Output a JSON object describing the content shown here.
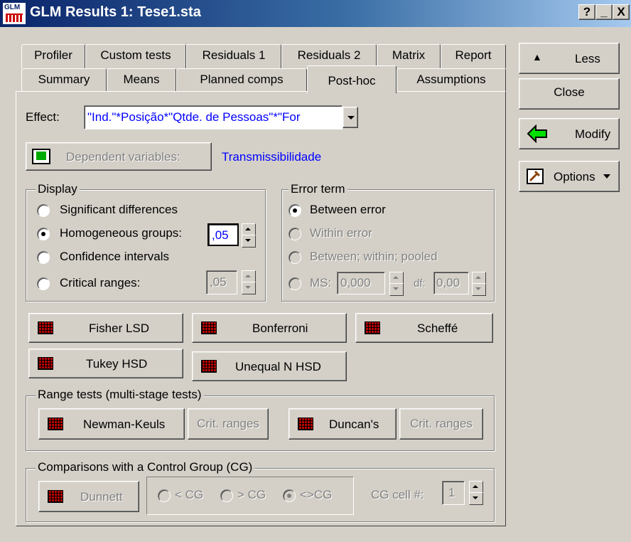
{
  "window": {
    "icon_text": "GLM",
    "title": "GLM Results 1: Tese1.sta",
    "help_btn": "?",
    "min_btn": "_",
    "close_btn": "X"
  },
  "tabs_row1": [
    "Profiler",
    "Custom tests",
    "Residuals 1",
    "Residuals 2",
    "Matrix",
    "Report"
  ],
  "tabs_row2": [
    "Summary",
    "Means",
    "Planned comps",
    "Post-hoc",
    "Assumptions"
  ],
  "active_tab": "Post-hoc",
  "effect": {
    "label": "Effect:",
    "value": "\"Ind.\"*Posição*\"Qtde. de Pessoas\"*\"For"
  },
  "dependent": {
    "button": "Dependent variables:",
    "value": "Transmissibilidade",
    "value_color": "#0000ff"
  },
  "display": {
    "title": "Display",
    "options": [
      {
        "label": "Significant differences",
        "checked": false,
        "enabled": true
      },
      {
        "label": "Homogeneous groups:",
        "checked": true,
        "enabled": true
      },
      {
        "label": "Confidence intervals",
        "checked": false,
        "enabled": true
      },
      {
        "label": "Critical ranges:",
        "checked": false,
        "enabled": true
      }
    ],
    "homog_value": ",05",
    "crit_value": ",05"
  },
  "error_term": {
    "title": "Error term",
    "options": [
      {
        "label": "Between error",
        "checked": true,
        "enabled": true
      },
      {
        "label": "Within error",
        "checked": false,
        "enabled": false
      },
      {
        "label": "Between; within; pooled",
        "checked": false,
        "enabled": false
      },
      {
        "label": "MS:",
        "checked": false,
        "enabled": false
      }
    ],
    "ms_value": "0,000",
    "df_label": "df:",
    "df_value": "0,00"
  },
  "tests": {
    "fisher": "Fisher LSD",
    "bonferroni": "Bonferroni",
    "scheffe": "Scheffé",
    "tukey": "Tukey HSD",
    "unequal": "Unequal N HSD"
  },
  "range_tests": {
    "title": "Range tests (multi-stage tests)",
    "newman": "Newman-Keuls",
    "crit1": "Crit. ranges",
    "duncan": "Duncan's",
    "crit2": "Crit. ranges"
  },
  "control": {
    "title": "Comparisons with a Control Group (CG)",
    "dunnett": "Dunnett",
    "opt_lt": "< CG",
    "opt_gt": "> CG",
    "opt_ne": "<>CG",
    "cell_label": "CG cell #:",
    "cell_value": "1"
  },
  "side": {
    "less": "Less",
    "close": "Close",
    "modify": "Modify",
    "options": "Options"
  }
}
